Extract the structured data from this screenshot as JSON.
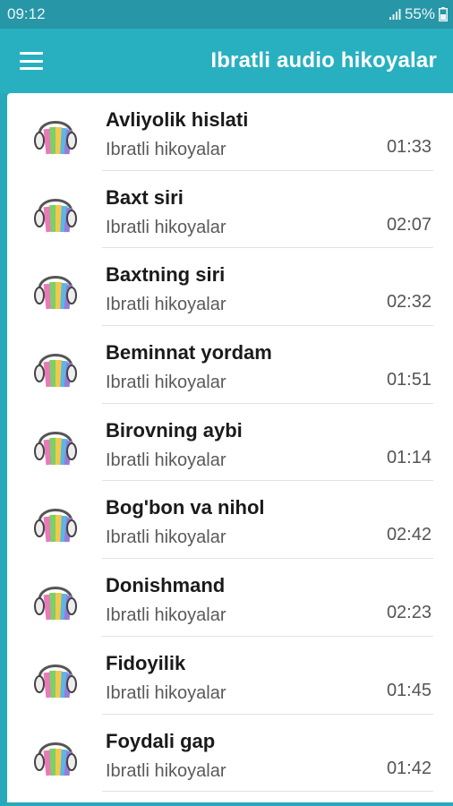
{
  "status_bar": {
    "time": "09:12",
    "battery": "55%"
  },
  "app_bar": {
    "title": "Ibratli audio hikoyalar",
    "menu_icon": "hamburger-menu-icon"
  },
  "items": [
    {
      "title": "Avliyolik hislati",
      "subtitle": "Ibratli hikoyalar",
      "duration": "01:33"
    },
    {
      "title": "Baxt siri",
      "subtitle": "Ibratli hikoyalar",
      "duration": "02:07"
    },
    {
      "title": "Baxtning siri",
      "subtitle": "Ibratli hikoyalar",
      "duration": "02:32"
    },
    {
      "title": "Beminnat yordam",
      "subtitle": "Ibratli hikoyalar",
      "duration": "01:51"
    },
    {
      "title": "Birovning aybi",
      "subtitle": "Ibratli hikoyalar",
      "duration": "01:14"
    },
    {
      "title": "Bog'bon va nihol",
      "subtitle": "Ibratli hikoyalar",
      "duration": "02:42"
    },
    {
      "title": "Donishmand",
      "subtitle": "Ibratli hikoyalar",
      "duration": "02:23"
    },
    {
      "title": "Fidoyilik",
      "subtitle": "Ibratli hikoyalar",
      "duration": "01:45"
    },
    {
      "title": "Foydali gap",
      "subtitle": "Ibratli hikoyalar",
      "duration": "01:42"
    }
  ],
  "colors": {
    "status_bar": "#2796a6",
    "app_bar": "#28b0c0",
    "card": "#ffffff"
  }
}
